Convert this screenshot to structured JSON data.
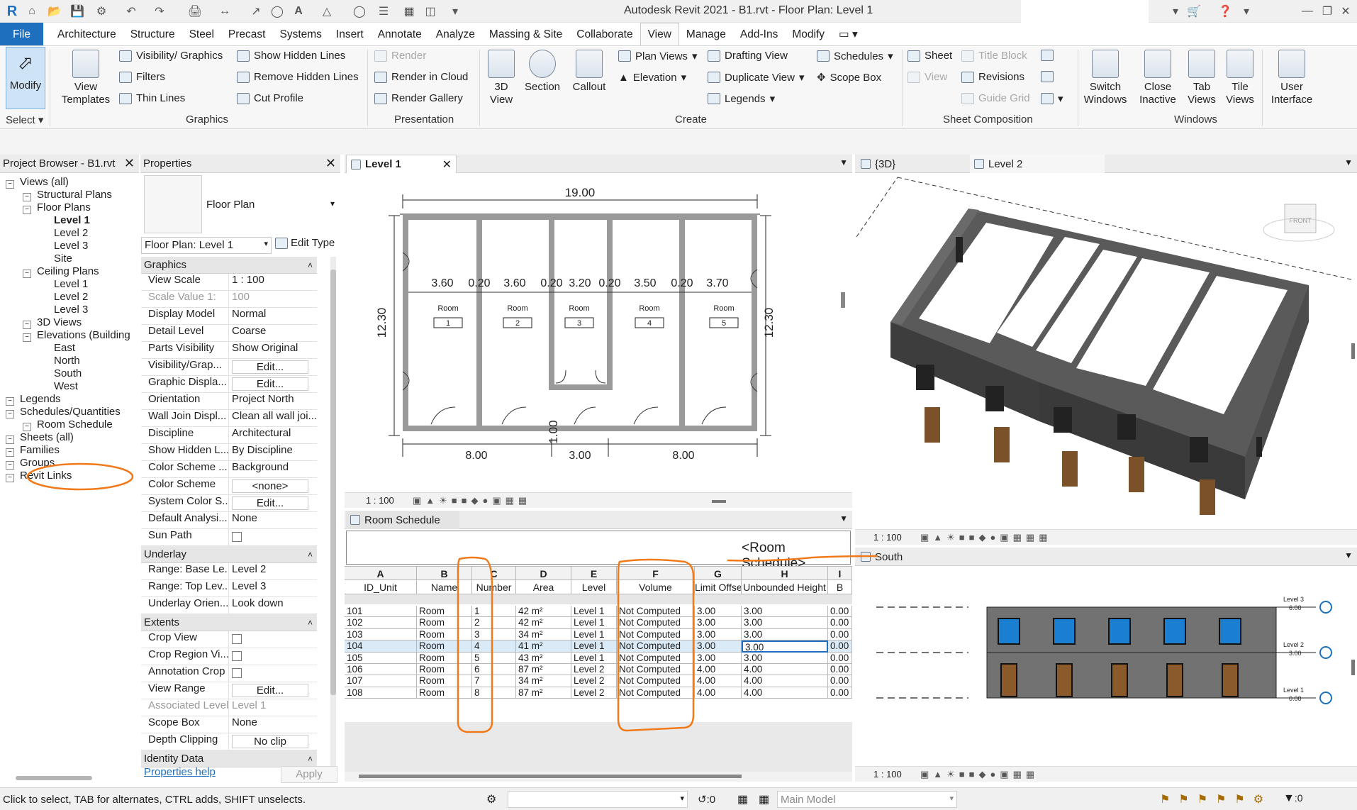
{
  "title": "Autodesk Revit 2021 - B1.rvt - Floor Plan: Level 1",
  "menu": [
    "File",
    "Architecture",
    "Structure",
    "Steel",
    "Precast",
    "Systems",
    "Insert",
    "Annotate",
    "Analyze",
    "Massing & Site",
    "Collaborate",
    "View",
    "Manage",
    "Add-Ins",
    "Modify"
  ],
  "active_menu": "View",
  "ribbon": {
    "modify": "Modify",
    "select": "Select",
    "view_templates": "View Templates",
    "visibility_graphics": "Visibility/ Graphics",
    "filters": "Filters",
    "thin_lines": "Thin  Lines",
    "show_hidden_lines": "Show  Hidden Lines",
    "remove_hidden_lines": "Remove  Hidden Lines",
    "cut_profile": "Cut  Profile",
    "graphics_label": "Graphics",
    "render": "Render",
    "render_in_cloud": "Render  in Cloud",
    "render_gallery": "Render  Gallery",
    "presentation_label": "Presentation",
    "three_d_view": "3D View",
    "section": "Section",
    "callout": "Callout",
    "plan_views": "Plan  Views",
    "elevation": "Elevation",
    "drafting_view": "Drafting  View",
    "duplicate_view": "Duplicate  View",
    "legends": "Legends",
    "schedules": "Schedules",
    "scope_box": "Scope  Box",
    "create_label": "Create",
    "sheet": "Sheet",
    "view": "View",
    "title_block": "Title  Block",
    "revisions": "Revisions",
    "guide_grid": "Guide  Grid",
    "sheet_composition_label": "Sheet Composition",
    "switch_windows": "Switch Windows",
    "close_inactive": "Close Inactive",
    "tab_views": "Tab Views",
    "tile_views": "Tile Views",
    "user_interface": "User Interface",
    "windows_label": "Windows"
  },
  "project_browser": {
    "title": "Project Browser - B1.rvt",
    "items": [
      {
        "label": "Views (all)",
        "indent": 0
      },
      {
        "label": "Structural Plans",
        "indent": 1
      },
      {
        "label": "Floor Plans",
        "indent": 1
      },
      {
        "label": "Level 1",
        "indent": 2,
        "bold": true
      },
      {
        "label": "Level 2",
        "indent": 2
      },
      {
        "label": "Level 3",
        "indent": 2
      },
      {
        "label": "Site",
        "indent": 2
      },
      {
        "label": "Ceiling Plans",
        "indent": 1
      },
      {
        "label": "Level 1",
        "indent": 2
      },
      {
        "label": "Level 2",
        "indent": 2
      },
      {
        "label": "Level 3",
        "indent": 2
      },
      {
        "label": "3D Views",
        "indent": 1
      },
      {
        "label": "Elevations (Building",
        "indent": 1
      },
      {
        "label": "East",
        "indent": 2
      },
      {
        "label": "North",
        "indent": 2
      },
      {
        "label": "South",
        "indent": 2
      },
      {
        "label": "West",
        "indent": 2
      },
      {
        "label": "Legends",
        "indent": 0
      },
      {
        "label": "Schedules/Quantities",
        "indent": 0
      },
      {
        "label": "Room Schedule",
        "indent": 1
      },
      {
        "label": "Sheets (all)",
        "indent": 0
      },
      {
        "label": "Families",
        "indent": 0
      },
      {
        "label": "Groups",
        "indent": 0
      },
      {
        "label": "Revit Links",
        "indent": 0
      }
    ]
  },
  "properties": {
    "title": "Properties",
    "type_name": "Floor Plan",
    "selector": "Floor Plan: Level 1",
    "edit_type": "Edit Type",
    "rows": [
      {
        "section": "Graphics"
      },
      {
        "k": "View Scale",
        "v": "1 : 100"
      },
      {
        "k": "Scale Value    1:",
        "v": "100",
        "gray": true
      },
      {
        "k": "Display Model",
        "v": "Normal"
      },
      {
        "k": "Detail Level",
        "v": "Coarse"
      },
      {
        "k": "Parts Visibility",
        "v": "Show Original"
      },
      {
        "k": "Visibility/Grap...",
        "v": "Edit...",
        "btn": true
      },
      {
        "k": "Graphic Displa...",
        "v": "Edit...",
        "btn": true
      },
      {
        "k": "Orientation",
        "v": "Project North"
      },
      {
        "k": "Wall Join Displ...",
        "v": "Clean all wall joi..."
      },
      {
        "k": "Discipline",
        "v": "Architectural"
      },
      {
        "k": "Show Hidden L...",
        "v": "By Discipline"
      },
      {
        "k": "Color Scheme ...",
        "v": "Background"
      },
      {
        "k": "Color Scheme",
        "v": "<none>",
        "btn": true
      },
      {
        "k": "System Color S...",
        "v": "Edit...",
        "btn": true
      },
      {
        "k": "Default Analysi...",
        "v": "None"
      },
      {
        "k": "Sun Path",
        "v": "",
        "check": true
      },
      {
        "section": "Underlay"
      },
      {
        "k": "Range: Base Le...",
        "v": "Level 2"
      },
      {
        "k": "Range: Top Lev...",
        "v": "Level 3"
      },
      {
        "k": "Underlay Orien...",
        "v": "Look down"
      },
      {
        "section": "Extents"
      },
      {
        "k": "Crop View",
        "v": "",
        "check": true
      },
      {
        "k": "Crop Region Vi...",
        "v": "",
        "check": true
      },
      {
        "k": "Annotation Crop",
        "v": "",
        "check": true
      },
      {
        "k": "View Range",
        "v": "Edit...",
        "btn": true
      },
      {
        "k": "Associated Level",
        "v": "Level 1",
        "gray": true
      },
      {
        "k": "Scope Box",
        "v": "None"
      },
      {
        "k": "Depth Clipping",
        "v": "No clip",
        "btn": true
      },
      {
        "section": "Identity Data"
      }
    ],
    "help": "Properties help",
    "apply": "Apply"
  },
  "plan_view": {
    "tab": "Level 1",
    "scale": "1 : 100",
    "dim_top": "19.00",
    "dim_left": "12.30",
    "dim_right": "12.30",
    "dim_inner": [
      "3.60",
      "0.20",
      "3.60",
      "0.20",
      "3.20",
      "0.20",
      "3.50",
      "0.20",
      "3.70"
    ],
    "dim_bottom": [
      "8.00",
      "3.00",
      "8.00"
    ],
    "dim_door": "1.00",
    "rooms": [
      {
        "name": "Room",
        "num": "1"
      },
      {
        "name": "Room",
        "num": "2"
      },
      {
        "name": "Room",
        "num": "3"
      },
      {
        "name": "Room",
        "num": "4"
      },
      {
        "name": "Room",
        "num": "5"
      }
    ]
  },
  "view_3d": {
    "tab": "{3D}",
    "tab2": "Level 2",
    "scale": "1 : 100",
    "cube": "FRONT"
  },
  "south_view": {
    "tab": "South",
    "scale": "1 : 100",
    "levels": [
      {
        "name": "Level 3",
        "elev": "6.00"
      },
      {
        "name": "Level 2",
        "elev": "3.00"
      },
      {
        "name": "Level 1",
        "elev": "0.00"
      }
    ]
  },
  "schedule": {
    "tab": "Room Schedule",
    "title": "<Room Schedule>",
    "letters": [
      "A",
      "B",
      "C",
      "D",
      "E",
      "F",
      "G",
      "H",
      "I"
    ],
    "headers": [
      "ID_Unit",
      "Name",
      "Number",
      "Area",
      "Level",
      "Volume",
      "Limit Offset",
      "Unbounded Height",
      "B"
    ],
    "rows": [
      [
        "101",
        "Room",
        "1",
        "42 m²",
        "Level 1",
        "Not Computed",
        "3.00",
        "3.00",
        "0.00"
      ],
      [
        "102",
        "Room",
        "2",
        "42 m²",
        "Level 1",
        "Not Computed",
        "3.00",
        "3.00",
        "0.00"
      ],
      [
        "103",
        "Room",
        "3",
        "34 m²",
        "Level 1",
        "Not Computed",
        "3.00",
        "3.00",
        "0.00"
      ],
      [
        "104",
        "Room",
        "4",
        "41 m²",
        "Level 1",
        "Not Computed",
        "3.00",
        "3.00",
        "0.00"
      ],
      [
        "105",
        "Room",
        "5",
        "43 m²",
        "Level 1",
        "Not Computed",
        "3.00",
        "3.00",
        "0.00"
      ],
      [
        "106",
        "Room",
        "6",
        "87 m²",
        "Level 2",
        "Not Computed",
        "4.00",
        "4.00",
        "0.00"
      ],
      [
        "107",
        "Room",
        "7",
        "34 m²",
        "Level 2",
        "Not Computed",
        "4.00",
        "4.00",
        "0.00"
      ],
      [
        "108",
        "Room",
        "8",
        "87 m²",
        "Level 2",
        "Not Computed",
        "4.00",
        "4.00",
        "0.00"
      ]
    ],
    "selected_row": 3
  },
  "status": {
    "message": "Click to select, TAB for alternates, CTRL adds, SHIFT unselects.",
    "count": ":0",
    "model": "Main Model",
    "filter_count": ":0"
  },
  "colors": {
    "accent": "#1f6fbf",
    "annotation": "#f07a1a",
    "building": "#3f3f3f",
    "window": "#1a7fd0",
    "door": "#8a5a2b"
  }
}
